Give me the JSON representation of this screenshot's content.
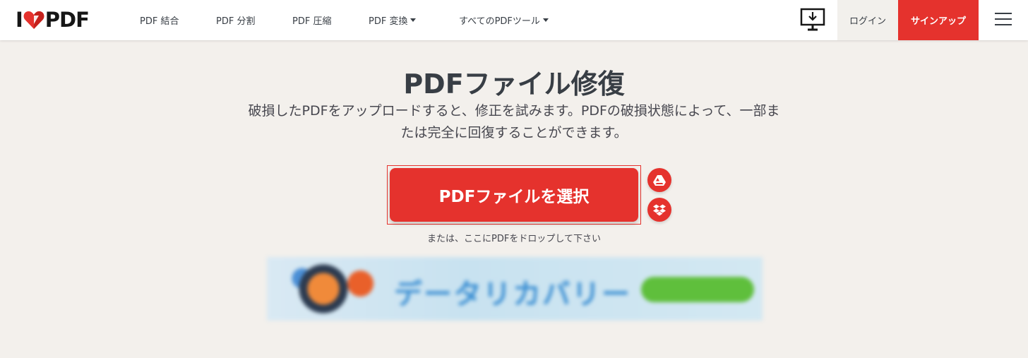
{
  "header": {
    "logo": {
      "left": "I",
      "right": "PDF"
    },
    "nav": [
      {
        "label": "PDF 結合",
        "has_caret": false
      },
      {
        "label": "PDF 分割",
        "has_caret": false
      },
      {
        "label": "PDF 圧縮",
        "has_caret": false
      },
      {
        "label": "PDF 変換",
        "has_caret": true
      },
      {
        "label": "すべてのPDFツール",
        "has_caret": true
      }
    ],
    "desktop_icon": "desktop-download-icon",
    "login_label": "ログイン",
    "signup_label": "サインアップ",
    "menu_icon": "hamburger-menu-icon"
  },
  "main": {
    "title": "PDFファイル修復",
    "subtitle": "破損したPDFをアップロードすると、修正を試みます。PDFの破損状態によって、一部または完全に回復することができます。",
    "select_button_label": "PDFファイルを選択",
    "cloud_buttons": [
      "google-drive-icon",
      "dropbox-icon"
    ],
    "drop_hint": "または、ここにPDFをドロップして下さい"
  },
  "ad": {
    "headline": "データリカバリー"
  },
  "colors": {
    "brand_red": "#e5322d",
    "background": "#f3f0ec",
    "text": "#383e45"
  }
}
